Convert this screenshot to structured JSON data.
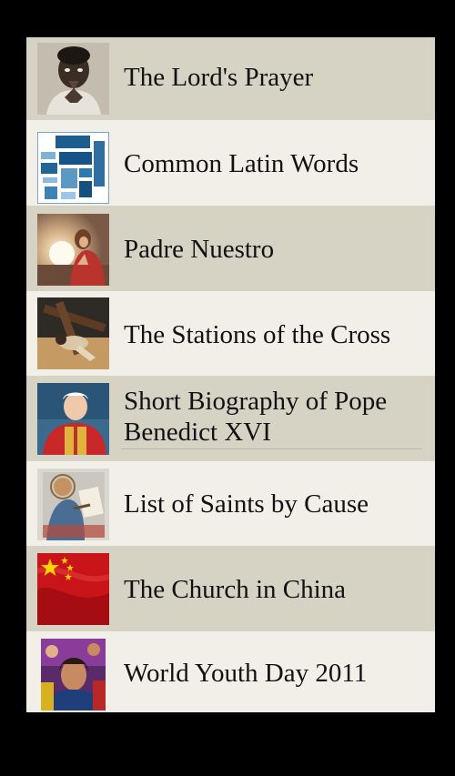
{
  "items": [
    {
      "label": "The Lord's Prayer",
      "thumb": "praying-child-photo"
    },
    {
      "label": "Common Latin Words",
      "thumb": "latin-word-cloud"
    },
    {
      "label": "Padre Nuestro",
      "thumb": "jesus-praying-painting"
    },
    {
      "label": "The Stations of the Cross",
      "thumb": "carrying-cross-painting"
    },
    {
      "label": "Short Biography of Pope Benedict XVI",
      "thumb": "pope-benedict-portrait"
    },
    {
      "label": "List of Saints by Cause",
      "thumb": "saint-writing-painting"
    },
    {
      "label": "The Church in China",
      "thumb": "china-flag"
    },
    {
      "label": "World Youth Day 2011",
      "thumb": "youth-crowd-photo"
    }
  ]
}
